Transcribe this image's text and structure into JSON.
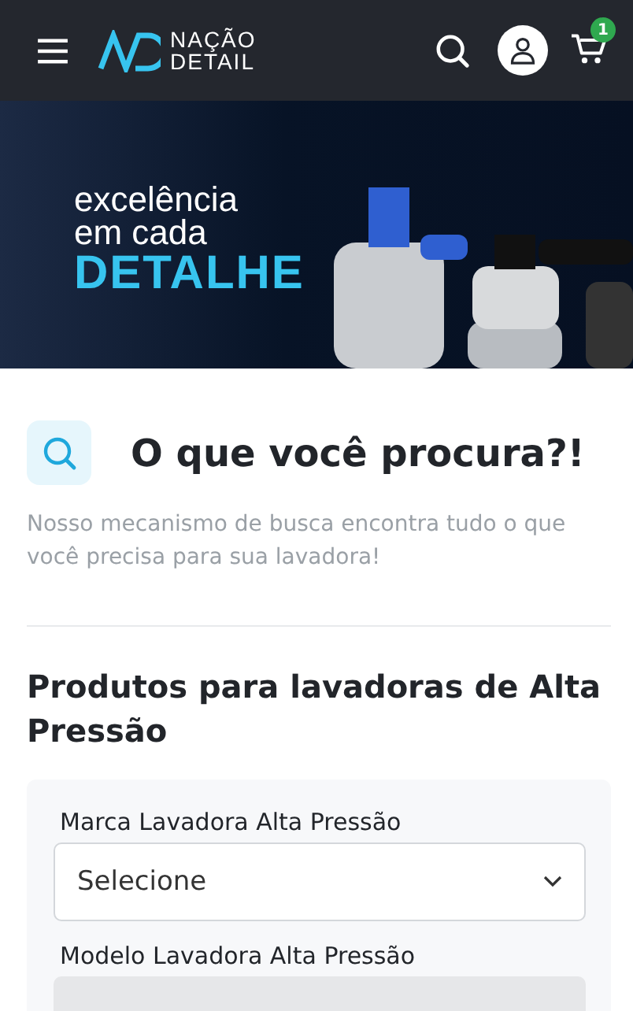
{
  "header": {
    "logo_line_1": "NAÇÃO",
    "logo_line_2": "DETAIL",
    "cart_count": "1"
  },
  "banner": {
    "line_1": "excelência",
    "line_2": "em cada",
    "line_3": "DETALHE"
  },
  "search_intro": {
    "title": "O que você procura?!",
    "description": "Nosso mecanismo de busca encontra tudo o que você precisa para sua lavadora!"
  },
  "filter": {
    "heading": "Produtos para lavadoras de Alta Pressão",
    "fields": [
      {
        "label": "Marca Lavadora Alta Pressão",
        "value": "Selecione",
        "disabled": false
      },
      {
        "label": "Modelo Lavadora Alta Pressão",
        "disabled": true
      }
    ]
  }
}
